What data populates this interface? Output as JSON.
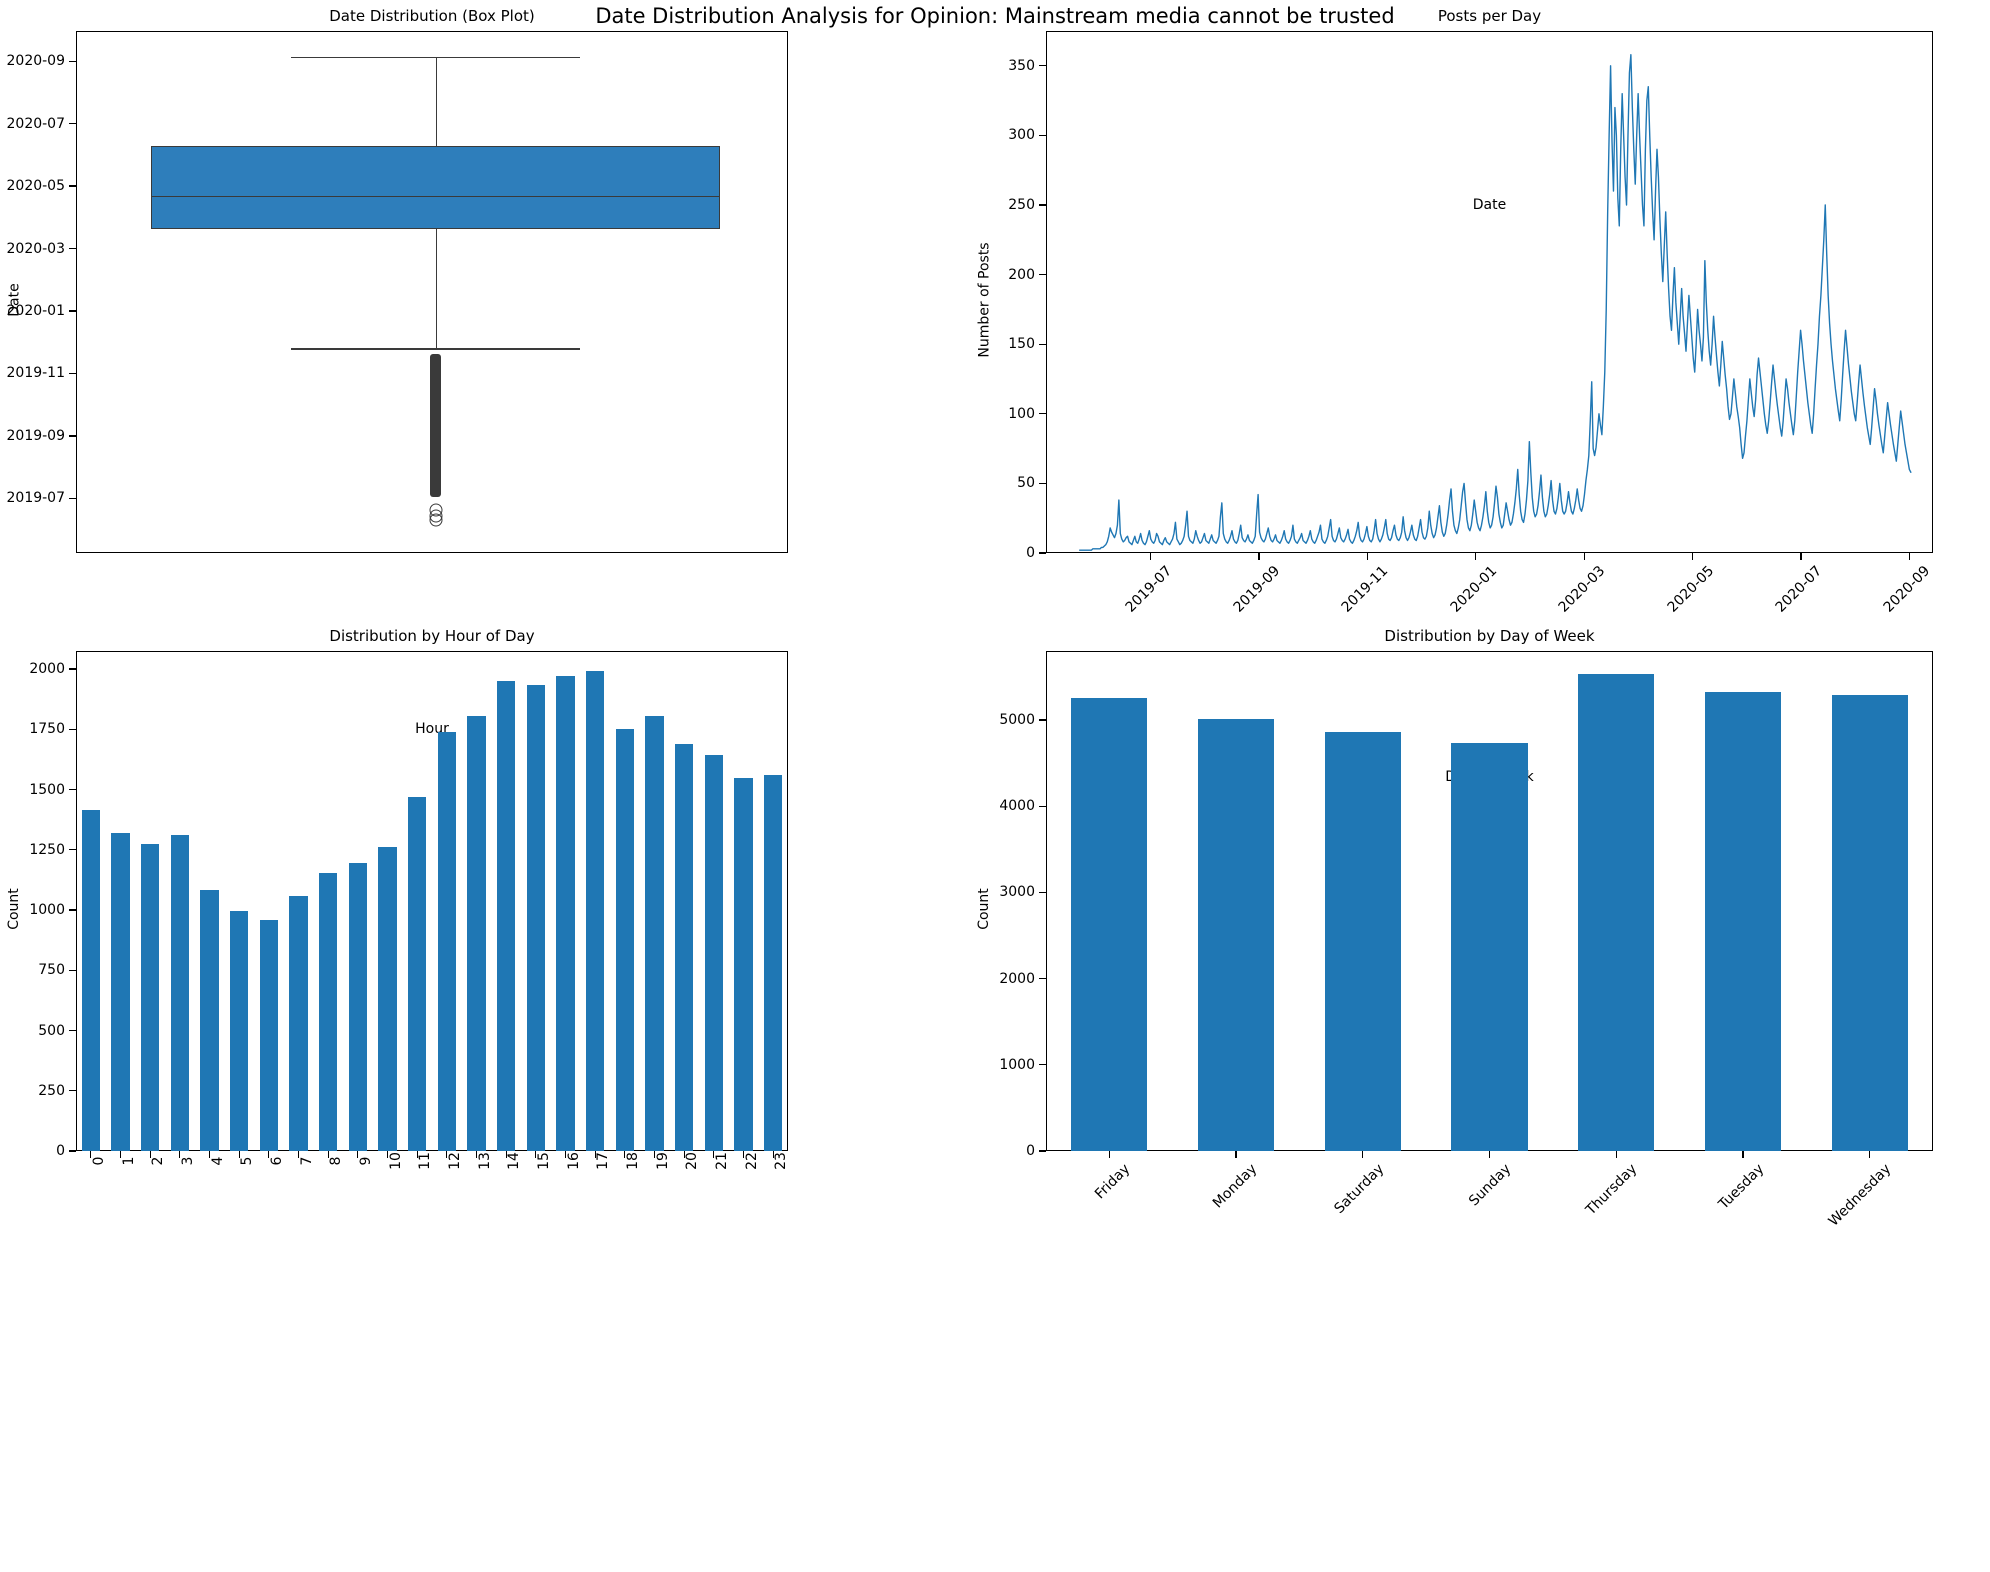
{
  "figure": {
    "suptitle": "Date Distribution Analysis for Opinion: Mainstream media cannot be trusted",
    "accent_color": "#1f77b4",
    "box_color": "#2e7ebb",
    "outlier_color": "#3a3a3a"
  },
  "chart_data": [
    {
      "type": "box",
      "title": "Date Distribution (Box Plot)",
      "xlabel": "",
      "ylabel": "Date",
      "grid": false,
      "yticklabels": [
        "2020-09",
        "2020-07",
        "2020-05",
        "2020-03",
        "2020-01",
        "2019-11",
        "2019-09",
        "2019-07"
      ],
      "ylim": [
        "2019-06-01",
        "2020-09-20"
      ],
      "box_stats": {
        "whisker_high": "2020-09-05",
        "q3": "2020-06-10",
        "median": "2020-04-22",
        "q1": "2020-03-20",
        "whisker_low": "2019-11-25",
        "outlier_band_top": "2019-11-20",
        "outlier_band_bottom": "2019-07-02",
        "isolated_outliers": [
          "2019-06-20",
          "2019-06-14",
          "2019-06-10"
        ]
      }
    },
    {
      "type": "line",
      "title": "Posts per Day",
      "xlabel": "Date",
      "ylabel": "Number of Posts",
      "grid": false,
      "ylim": [
        0,
        375
      ],
      "yticks": [
        0,
        50,
        100,
        150,
        200,
        250,
        300,
        350
      ],
      "xticklabels": [
        "2019-07",
        "2019-09",
        "2019-11",
        "2020-01",
        "2020-03",
        "2020-05",
        "2020-07",
        "2020-09"
      ],
      "xlim": [
        "2019-06-01",
        "2020-09-10"
      ],
      "series_name": "Number of Posts",
      "values": [
        2,
        2,
        2,
        2,
        2,
        2,
        2,
        2,
        2,
        3,
        3,
        3,
        3,
        3,
        3,
        4,
        4,
        5,
        6,
        8,
        12,
        18,
        15,
        13,
        11,
        14,
        20,
        38,
        14,
        10,
        8,
        9,
        11,
        12,
        8,
        7,
        6,
        9,
        12,
        8,
        7,
        10,
        14,
        9,
        7,
        6,
        8,
        12,
        16,
        10,
        8,
        7,
        9,
        14,
        12,
        8,
        7,
        6,
        9,
        11,
        8,
        7,
        6,
        8,
        10,
        14,
        22,
        10,
        8,
        6,
        7,
        9,
        12,
        20,
        30,
        12,
        9,
        8,
        7,
        10,
        16,
        12,
        9,
        7,
        8,
        11,
        14,
        9,
        8,
        7,
        10,
        13,
        9,
        8,
        7,
        9,
        12,
        26,
        36,
        14,
        10,
        8,
        7,
        9,
        12,
        16,
        10,
        8,
        7,
        9,
        14,
        20,
        11,
        9,
        8,
        10,
        13,
        9,
        8,
        7,
        9,
        12,
        28,
        42,
        15,
        11,
        9,
        8,
        10,
        14,
        18,
        12,
        9,
        8,
        10,
        13,
        9,
        8,
        7,
        9,
        12,
        16,
        10,
        8,
        7,
        9,
        12,
        20,
        10,
        8,
        7,
        9,
        11,
        14,
        9,
        8,
        7,
        9,
        12,
        16,
        10,
        8,
        7,
        9,
        12,
        15,
        20,
        10,
        8,
        7,
        9,
        12,
        18,
        24,
        12,
        9,
        8,
        10,
        14,
        18,
        11,
        9,
        8,
        10,
        13,
        17,
        10,
        8,
        7,
        9,
        12,
        16,
        22,
        12,
        9,
        8,
        10,
        14,
        19,
        12,
        9,
        8,
        10,
        16,
        24,
        14,
        10,
        8,
        10,
        13,
        18,
        24,
        14,
        10,
        9,
        11,
        16,
        20,
        13,
        10,
        9,
        11,
        15,
        26,
        16,
        11,
        9,
        11,
        15,
        20,
        13,
        10,
        9,
        12,
        18,
        24,
        15,
        11,
        10,
        12,
        18,
        30,
        20,
        14,
        11,
        13,
        18,
        26,
        34,
        22,
        15,
        12,
        14,
        20,
        28,
        38,
        46,
        30,
        20,
        16,
        14,
        18,
        24,
        34,
        44,
        50,
        36,
        24,
        18,
        16,
        20,
        28,
        38,
        30,
        22,
        18,
        16,
        20,
        26,
        34,
        44,
        30,
        22,
        18,
        20,
        26,
        36,
        48,
        40,
        28,
        22,
        18,
        20,
        28,
        36,
        30,
        24,
        20,
        22,
        28,
        36,
        46,
        60,
        42,
        30,
        24,
        22,
        28,
        38,
        52,
        80,
        58,
        40,
        30,
        26,
        28,
        34,
        44,
        56,
        40,
        30,
        26,
        28,
        34,
        42,
        52,
        38,
        30,
        28,
        32,
        40,
        50,
        38,
        30,
        28,
        30,
        36,
        44,
        36,
        30,
        28,
        32,
        38,
        46,
        38,
        32,
        30,
        34,
        42,
        52,
        60,
        70,
        95,
        123,
        75,
        70,
        76,
        88,
        100,
        92,
        85,
        105,
        130,
        175,
        245,
        300,
        350,
        295,
        260,
        320,
        300,
        255,
        235,
        290,
        330,
        300,
        270,
        250,
        300,
        345,
        358,
        320,
        290,
        265,
        300,
        330,
        300,
        275,
        250,
        235,
        290,
        325,
        335,
        300,
        270,
        245,
        225,
        260,
        290,
        270,
        240,
        215,
        195,
        220,
        245,
        215,
        190,
        170,
        160,
        185,
        205,
        180,
        165,
        150,
        170,
        190,
        170,
        158,
        145,
        165,
        185,
        170,
        155,
        140,
        130,
        150,
        175,
        160,
        150,
        138,
        155,
        210,
        180,
        160,
        145,
        135,
        150,
        170,
        155,
        142,
        130,
        120,
        135,
        152,
        140,
        128,
        118,
        105,
        96,
        100,
        112,
        125,
        115,
        105,
        98,
        90,
        78,
        68,
        72,
        84,
        95,
        110,
        125,
        115,
        105,
        98,
        110,
        128,
        140,
        130,
        120,
        110,
        100,
        92,
        86,
        95,
        108,
        122,
        135,
        125,
        115,
        106,
        98,
        90,
        84,
        95,
        110,
        125,
        118,
        108,
        100,
        92,
        85,
        95,
        112,
        130,
        145,
        160,
        150,
        138,
        128,
        118,
        108,
        100,
        92,
        86,
        100,
        118,
        135,
        150,
        170,
        185,
        205,
        225,
        250,
        215,
        185,
        165,
        150,
        138,
        128,
        118,
        110,
        102,
        95,
        110,
        128,
        145,
        160,
        148,
        136,
        126,
        116,
        108,
        100,
        95,
        108,
        122,
        135,
        125,
        115,
        106,
        98,
        90,
        84,
        78,
        90,
        104,
        118,
        110,
        100,
        92,
        85,
        78,
        72,
        84,
        96,
        108,
        100,
        92,
        85,
        78,
        72,
        66,
        78,
        90,
        102,
        94,
        86,
        78,
        72,
        66,
        60,
        58
      ]
    },
    {
      "type": "bar",
      "title": "Distribution by Hour of Day",
      "xlabel": "Hour",
      "ylabel": "Count",
      "grid": false,
      "ylim": [
        0,
        2075
      ],
      "yticks": [
        0,
        250,
        500,
        750,
        1000,
        1250,
        1500,
        1750,
        2000
      ],
      "categories": [
        "0",
        "1",
        "2",
        "3",
        "4",
        "5",
        "6",
        "7",
        "8",
        "9",
        "10",
        "11",
        "12",
        "13",
        "14",
        "15",
        "16",
        "17",
        "18",
        "19",
        "20",
        "21",
        "22",
        "23"
      ],
      "values": [
        1415,
        1320,
        1275,
        1310,
        1085,
        995,
        960,
        1060,
        1155,
        1195,
        1260,
        1470,
        1740,
        1805,
        1950,
        1935,
        1970,
        1990,
        1750,
        1805,
        1690,
        1645,
        1550,
        1560
      ]
    },
    {
      "type": "bar",
      "title": "Distribution by Day of Week",
      "xlabel": "Day of Week",
      "ylabel": "Count",
      "grid": false,
      "ylim": [
        0,
        5800
      ],
      "yticks": [
        0,
        1000,
        2000,
        3000,
        4000,
        5000
      ],
      "categories": [
        "Friday",
        "Monday",
        "Saturday",
        "Sunday",
        "Thursday",
        "Tuesday",
        "Wednesday"
      ],
      "values": [
        5255,
        5010,
        4855,
        4730,
        5535,
        5320,
        5285
      ]
    }
  ]
}
